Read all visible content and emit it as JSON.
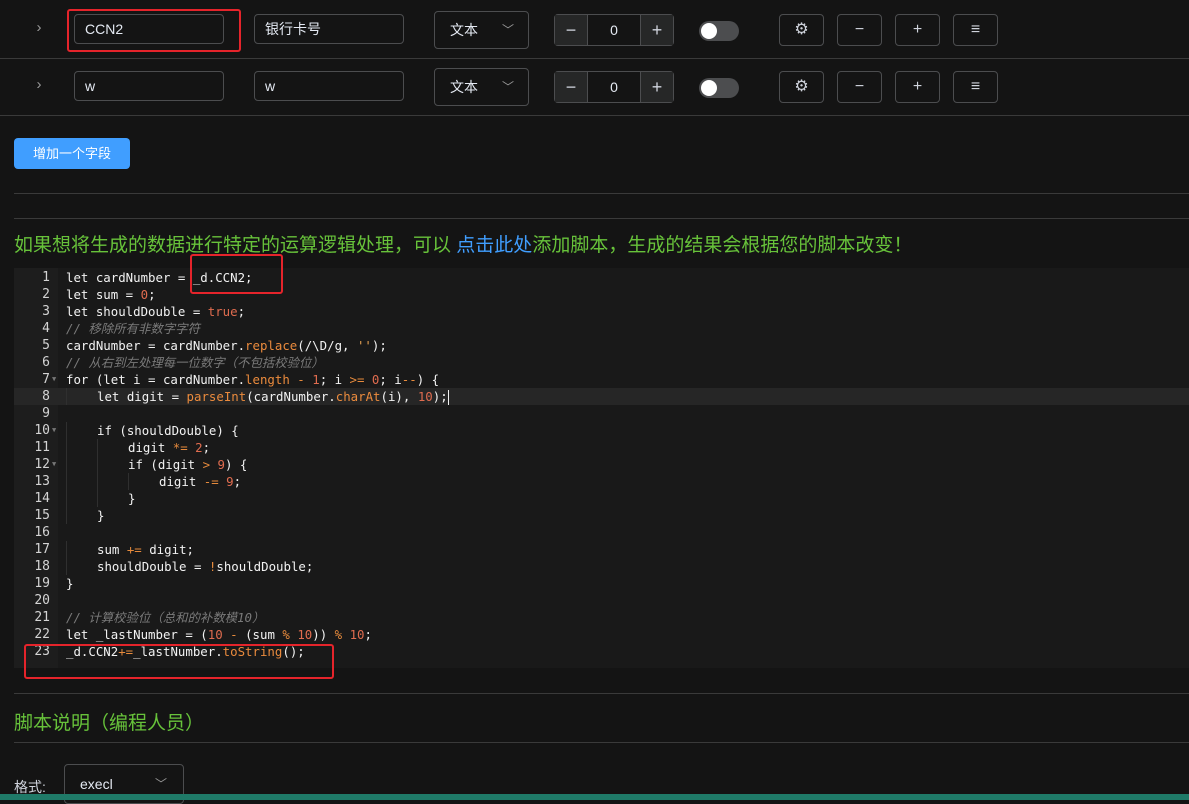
{
  "rows": [
    {
      "name_value": "CCN2",
      "label_value": "银行卡号",
      "type": "文本",
      "count": "0",
      "toggle_on": false
    },
    {
      "name_value": "w",
      "label_value": "w",
      "type": "文本",
      "count": "0",
      "toggle_on": false
    }
  ],
  "icons": {
    "expand": "chevron-right-icon",
    "dropdown": "chevron-down-icon",
    "settings": "gear-icon",
    "remove": "minus-icon",
    "add": "plus-icon",
    "menu": "list-icon"
  },
  "add_field_button": "增加一个字段",
  "notice": {
    "prefix": "如果想将生成的数据进行特定的运算逻辑处理，可以",
    "link": "点击此处",
    "suffix": "添加脚本，生成的结果会根据您的脚本改变！"
  },
  "editor": {
    "active_line": 8,
    "line_numbers": [
      "1",
      "2",
      "3",
      "4",
      "5",
      "6",
      "7",
      "8",
      "9",
      "10",
      "11",
      "12",
      "13",
      "14",
      "15",
      "16",
      "17",
      "18",
      "19",
      "20",
      "21",
      "22",
      "23"
    ],
    "lines": [
      "let cardNumber = _d.CCN2;",
      "let sum = 0;",
      "let shouldDouble = true;",
      "// 移除所有非数字字符",
      "cardNumber = cardNumber.replace(/\\D/g, '');",
      "// 从右到左处理每一位数字（不包括校验位）",
      "for (let i = cardNumber.length - 1; i >= 0; i--) {",
      "    let digit = parseInt(cardNumber.charAt(i), 10);",
      "",
      "    if (shouldDouble) {",
      "        digit *= 2;",
      "        if (digit > 9) {",
      "            digit -= 9;",
      "        }",
      "    }",
      "",
      "    sum += digit;",
      "    shouldDouble = !shouldDouble;",
      "}",
      "",
      "// 计算校验位（总和的补数模10）",
      "let _lastNumber = (10 - (sum % 10)) % 10;",
      "_d.CCN2+=_lastNumber.toString();"
    ]
  },
  "script_desc_title": "脚本说明（编程人员）",
  "format": {
    "label": "格式:",
    "value": "execl"
  },
  "colors": {
    "accent": "#409eff",
    "notice_green": "#67c23a",
    "highlight_red": "#e5242b",
    "background": "#141414"
  }
}
